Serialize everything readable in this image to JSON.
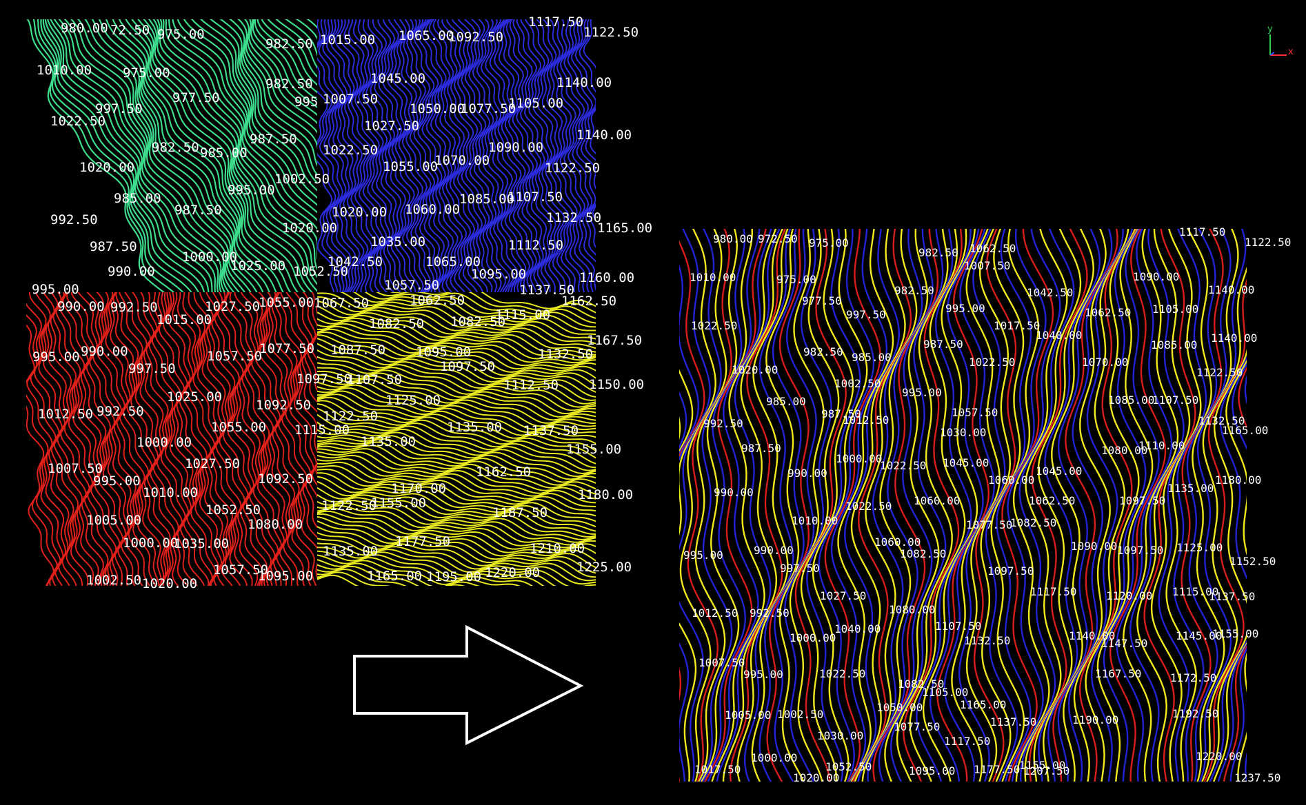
{
  "colors": {
    "background": "#000000",
    "tile_nw": "#3ddc8c",
    "tile_ne": "#2b2bdc",
    "tile_sw": "#e0201a",
    "tile_se": "#e8e820",
    "merged_blue": "#2323d6",
    "merged_yellow": "#f2e81e",
    "merged_red": "#d81c1c",
    "arrow": "#ffffff",
    "axis_x": "#ff3030",
    "axis_y": "#30d050",
    "axis_z": "#3050ff"
  },
  "axes_icon": {
    "y_label": "y",
    "x_label": "x"
  },
  "arrow": {
    "icon": "right-arrow-outline-icon"
  },
  "left_map": {
    "name": "tiled-contour-map",
    "labels": [
      "980.00",
      "72.50",
      "975.00",
      "982.50",
      "1015.00",
      "1065.00",
      "1092.50",
      "1117.50",
      "1122.50",
      "1010.00",
      "975.00",
      "982.50",
      "1045.00",
      "1140.00",
      "997.50",
      "977.50",
      "995",
      "1007.50",
      "1050.00",
      "1077.50",
      "1105.00",
      "1022.50",
      "1027.50",
      "1140.00",
      "982.50",
      "985.00",
      "987.50",
      "1022.50",
      "1090.00",
      "1020.00",
      "1055.00",
      "1070.00",
      "1122.50",
      "1002.50",
      "995.00",
      "985.00",
      "987.50",
      "1085.00",
      "1107.50",
      "992.50",
      "1020.00",
      "1060.00",
      "1132.50",
      "1020.00",
      "1165.00",
      "987.50",
      "1035.00",
      "1112.50",
      "1000.00",
      "1025.00",
      "990.00",
      "1042.50",
      "1065.00",
      "1052.50",
      "1095.00",
      "1160.00",
      "995.00",
      "1057.50",
      "1137.50",
      "990.00",
      "992.50",
      "1027.50",
      "1055.00",
      "1067.50",
      "1062.50",
      "1162.50",
      "1015.00",
      "1082.50",
      "1082.50",
      "1115.00",
      "1167.50",
      "990.00",
      "1077.50",
      "995.00",
      "1057.50",
      "1087.50",
      "1095.00",
      "1132.50",
      "997.50",
      "1097.50",
      "1097.50",
      "1107.50",
      "1112.50",
      "1150.00",
      "1025.00",
      "1125.00",
      "1012.50",
      "992.50",
      "1092.50",
      "1122.50",
      "1055.00",
      "1115.00",
      "1135.00",
      "1137.50",
      "1000.00",
      "1135.00",
      "1155.00",
      "1027.50",
      "1007.50",
      "995.00",
      "1092.50",
      "1162.50",
      "1010.00",
      "1170.00",
      "1180.00",
      "1052.50",
      "1122.50",
      "1155.00",
      "1187.50",
      "1005.00",
      "1080.00",
      "1000.00",
      "1035.00",
      "1177.50",
      "1210.00",
      "1135.00",
      "1057.50",
      "1225.00",
      "1165.00",
      "1195.00",
      "1220.00",
      "1002.50",
      "1020.00",
      "1095.00"
    ]
  },
  "right_map": {
    "name": "merged-contour-map",
    "labels": [
      "980.00",
      "972.50",
      "975.00",
      "982.50",
      "1062.50",
      "1117.50",
      "1122.50",
      "1010.00",
      "975.00",
      "1007.50",
      "1090.00",
      "982.50",
      "1042.50",
      "1140.00",
      "977.50",
      "997.50",
      "995.00",
      "1062.50",
      "1105.00",
      "1022.50",
      "1017.50",
      "1040.00",
      "987.50",
      "1085.00",
      "1140.00",
      "982.50",
      "985.00",
      "1022.50",
      "1070.00",
      "1020.00",
      "1122.50",
      "1002.50",
      "995.00",
      "1085.00",
      "1107.50",
      "985.00",
      "987.50",
      "1057.50",
      "1012.50",
      "1132.50",
      "992.50",
      "1030.00",
      "1165.00",
      "1080.00",
      "1110.00",
      "987.50",
      "1000.00",
      "1022.50",
      "1045.00",
      "1045.00",
      "990.00",
      "1060.00",
      "1180.00",
      "1060.00",
      "1062.50",
      "1097.50",
      "990.00",
      "1022.50",
      "1135.00",
      "1010.00",
      "1077.50",
      "1082.50",
      "1060.00",
      "995.00",
      "990.00",
      "1090.00",
      "1097.50",
      "1125.00",
      "1082.50",
      "997.50",
      "1152.50",
      "1097.50",
      "992.50",
      "1027.50",
      "1117.50",
      "1120.00",
      "1115.00",
      "1137.50",
      "1012.50",
      "1080.00",
      "1040.00",
      "1000.00",
      "1107.50",
      "1140.00",
      "1145.00",
      "1155.00",
      "1132.50",
      "1147.50",
      "1007.50",
      "995.00",
      "1022.50",
      "1082.50",
      "1167.50",
      "1172.50",
      "1105.00",
      "1050.00",
      "1165.00",
      "1002.50",
      "1005.00",
      "1137.50",
      "1190.00",
      "1192.50",
      "1077.50",
      "1030.00",
      "1117.50",
      "1000.00",
      "1220.00",
      "1052.50",
      "1155.00",
      "1017.50",
      "1095.00",
      "1177.50",
      "1207.50",
      "1020.00",
      "1237.50"
    ]
  }
}
